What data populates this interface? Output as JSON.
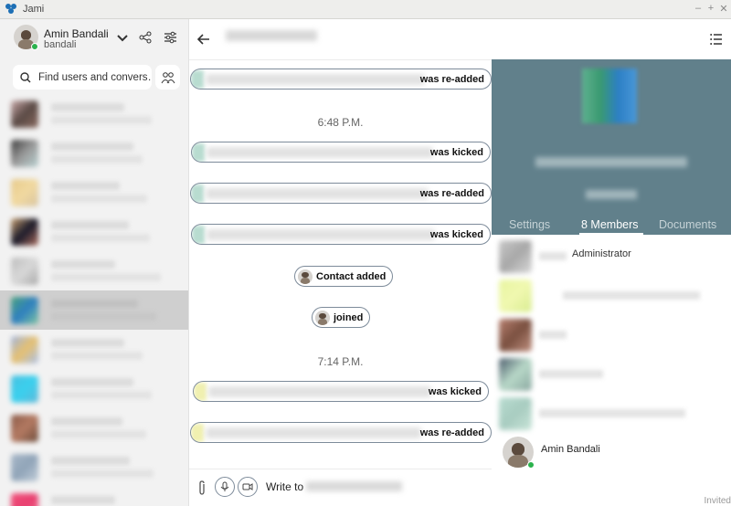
{
  "window": {
    "title": "Jami"
  },
  "account": {
    "name": "Amin Bandali",
    "username": "bandali"
  },
  "search": {
    "placeholder": "Find users and convers…"
  },
  "chat": {
    "events": [
      {
        "text": "was re-added"
      },
      {
        "time": "6:48 P.M."
      },
      {
        "text": "was kicked"
      },
      {
        "text": "was re-added"
      },
      {
        "text": "was kicked"
      },
      {
        "text": "Contact added"
      },
      {
        "text": "joined"
      },
      {
        "time": "7:14 P.M."
      },
      {
        "text": "was kicked"
      },
      {
        "text": "was re-added"
      }
    ],
    "composer_label": "Write to"
  },
  "details": {
    "tabs": [
      "Settings",
      "8 Members",
      "Documents"
    ],
    "active_tab": "8 Members",
    "members": [
      {
        "role": "Administrator"
      },
      {
        "name": "Amin Bandali",
        "status": "Invited"
      }
    ]
  },
  "colors": {
    "banner": "#61808b",
    "online": "#2bb24c",
    "selected_row": "#cfcfcf"
  }
}
